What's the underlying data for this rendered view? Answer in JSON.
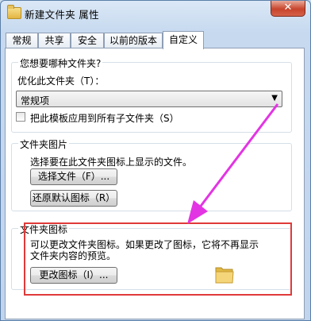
{
  "window": {
    "title": "新建文件夹 属性",
    "close_glyph": "✕"
  },
  "tabs": [
    {
      "label": "常规",
      "active": false
    },
    {
      "label": "共享",
      "active": false
    },
    {
      "label": "安全",
      "active": false
    },
    {
      "label": "以前的版本",
      "active": false
    },
    {
      "label": "自定义",
      "active": true
    }
  ],
  "folder_type": {
    "group_title": "您想要哪种文件夹?",
    "optimize_label": "优化此文件夹（T）：",
    "combo_value": "常规项",
    "apply_checkbox_label": "把此模板应用到所有子文件夹（S）",
    "apply_checked": false
  },
  "folder_picture": {
    "group_title": "文件夹图片",
    "description": "选择要在此文件夹图标上显示的文件。",
    "choose_file_button": "选择文件（F）...",
    "restore_default_button": "还原默认图标（R）"
  },
  "folder_icon": {
    "group_title": "文件夹图标",
    "description_line1": "可以更改文件夹图标。如果更改了图标，它将不再显示",
    "description_line2": "文件夹内容的预览。",
    "change_icon_button": "更改图标（I）...",
    "icon": "folder-icon"
  },
  "annotations": {
    "highlight_color": "#e03a3a",
    "arrow_color": "#e334e3"
  }
}
